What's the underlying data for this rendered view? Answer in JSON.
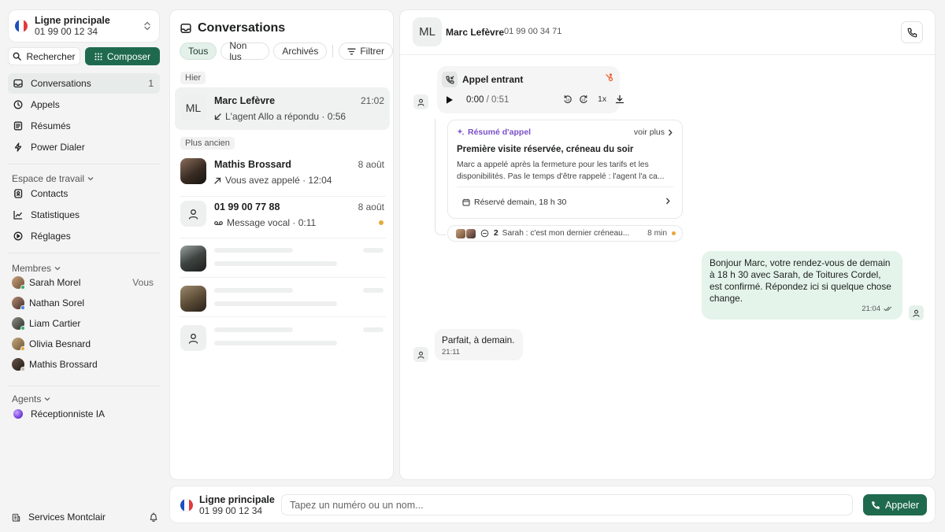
{
  "colors": {
    "accent_green": "#1f6a4e",
    "active_chip_bg": "#e4f1ea",
    "outgoing_bubble_bg": "#e4f4ea",
    "summary_accent": "#7b4fc9",
    "unread_dot": "#e7a93b"
  },
  "sidebar": {
    "line": {
      "title": "Ligne principale",
      "number": "01 99 00 12 34",
      "flag": "france-flag-icon"
    },
    "search_label": "Rechercher",
    "compose_label": "Composer",
    "nav": [
      {
        "label": "Conversations",
        "icon": "inbox-icon",
        "count": "1",
        "active": true
      },
      {
        "label": "Appels",
        "icon": "clock-icon",
        "count": ""
      },
      {
        "label": "Résumés",
        "icon": "document-icon",
        "count": ""
      },
      {
        "label": "Power Dialer",
        "icon": "bolt-icon",
        "count": ""
      }
    ],
    "workspace_heading": "Espace de travail",
    "workspace": [
      {
        "label": "Contacts",
        "icon": "contacts-icon"
      },
      {
        "label": "Statistiques",
        "icon": "chart-icon"
      },
      {
        "label": "Réglages",
        "icon": "settings-icon"
      }
    ],
    "members_heading": "Membres",
    "members": [
      {
        "name": "Sarah Morel",
        "note": "Vous",
        "status": "#2fb36b"
      },
      {
        "name": "Nathan Sorel",
        "note": "",
        "status": "#4a7cf0"
      },
      {
        "name": "Liam Cartier",
        "note": "",
        "status": "#2fb36b"
      },
      {
        "name": "Olivia Besnard",
        "note": "",
        "status": "#e7a93b"
      },
      {
        "name": "Mathis Brossard",
        "note": "",
        "status": "#bbbbbb"
      }
    ],
    "agents_heading": "Agents",
    "agents": [
      {
        "name": "Réceptionniste IA"
      }
    ],
    "footer": {
      "org": "Services Montclair"
    }
  },
  "conversations": {
    "title": "Conversations",
    "filters": [
      "Tous",
      "Non lus",
      "Archivés"
    ],
    "filter_button": "Filtrer",
    "group_yesterday": "Hier",
    "group_older": "Plus ancien",
    "items": [
      {
        "initials": "ML",
        "name": "Marc Lefèvre",
        "time": "21:02",
        "sub": "L'agent Allo a répondu · 0:56",
        "icon": "arrow-in-icon"
      },
      {
        "initials": "",
        "name": "Mathis Brossard",
        "time": "8 août",
        "sub": "Vous avez appelé · 12:04",
        "icon": "arrow-out-icon"
      },
      {
        "initials": "",
        "name": "01 99 00 77 88",
        "time": "8 août",
        "sub": "Message vocal · 0:11",
        "icon": "voicemail-icon",
        "unread": true
      }
    ]
  },
  "chat": {
    "initials": "ML",
    "name": "Marc Lefèvre",
    "number": "01 99 00 34 71",
    "call": {
      "title": "Appel entrant",
      "position": "0:00",
      "duration": "/ 0:51",
      "speed": "1x"
    },
    "summary": {
      "tag": "Résumé d'appel",
      "more": "voir plus",
      "title": "Première visite réservée, créneau du soir",
      "body": "Marc a appelé après la fermeture pour les tarifs et les disponibilités. Pas le temps d'être rappelé : l'agent l'a ca...",
      "reserved": "Réservé demain, 18 h 30"
    },
    "thread": {
      "count": "2",
      "preview": "Sarah : c'est mon dernier créneau...",
      "time": "8 min"
    },
    "outgoing": {
      "text": "Bonjour Marc, votre rendez-vous de demain à 18 h 30 avec Sarah, de Toitures Cordel, est confirmé. Répondez ici si quelque chose change.",
      "time": "21:04"
    },
    "incoming": {
      "text": "Parfait, à demain.",
      "time": "21:11"
    }
  },
  "dialbar": {
    "line_title": "Ligne principale",
    "line_number": "01 99 00 12 34",
    "placeholder": "Tapez un numéro ou un nom...",
    "call_label": "Appeler"
  }
}
